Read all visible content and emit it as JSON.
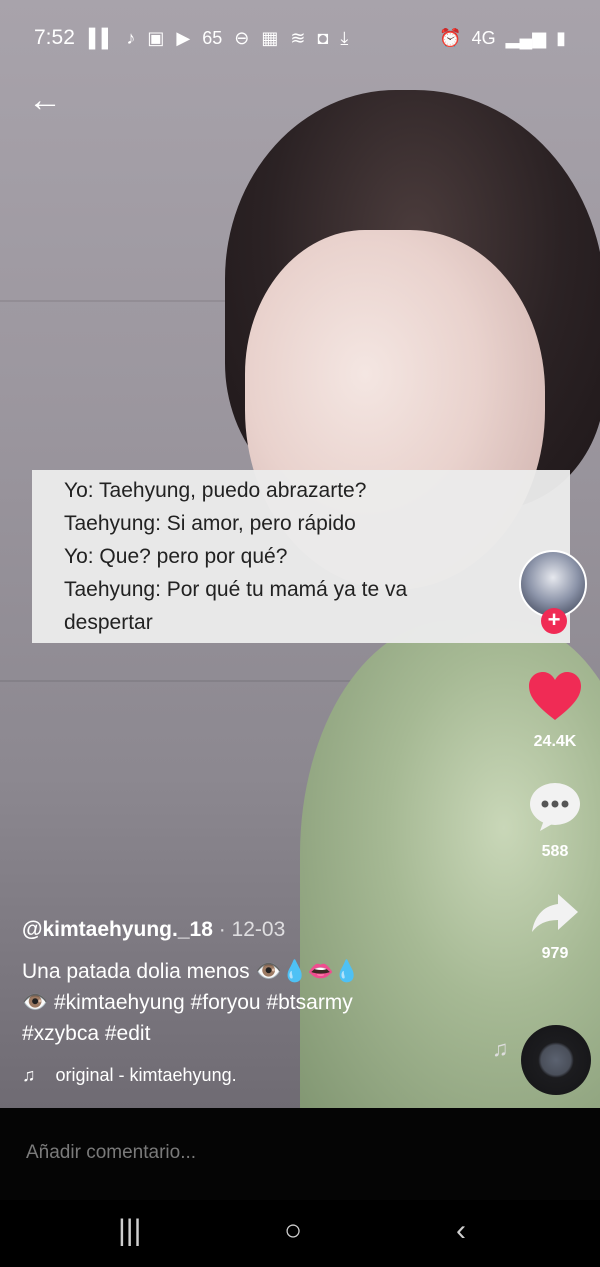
{
  "status_bar": {
    "time": "7:52",
    "left_icons": [
      "bts-icon",
      "tiktok-icon",
      "a-icon",
      "youtube-icon",
      "weather-65-icon",
      "dnd-icon",
      "youtube-icon",
      "gallery-icon",
      "wifi-icon",
      "shield-icon",
      "download-icon"
    ],
    "weather_text": "65",
    "right_text": "4G"
  },
  "video": {
    "overlay_text_lines": [
      "Yo: Taehyung, puedo abrazarte?",
      "Taehyung: Si amor, pero rápido",
      "Yo: Que? pero por qué?",
      "Taehyung: Por qué tu mamá ya te va",
      "despertar"
    ]
  },
  "actions": {
    "likes": "24.4K",
    "comments": "588",
    "shares": "979"
  },
  "post": {
    "username": "@kimtaehyung._18",
    "date": "· 12-03",
    "description_line1": "Una patada dolia menos 👁️💧👄💧",
    "description_line2": "👁️ #kimtaehyung #foryou #btsarmy",
    "description_line3": "#xzybca #edit",
    "music": "original - kimtaehyung."
  },
  "comment": {
    "placeholder": "Añadir comentario..."
  },
  "colors": {
    "like": "#f02b55",
    "comment_bar": "#050505"
  }
}
